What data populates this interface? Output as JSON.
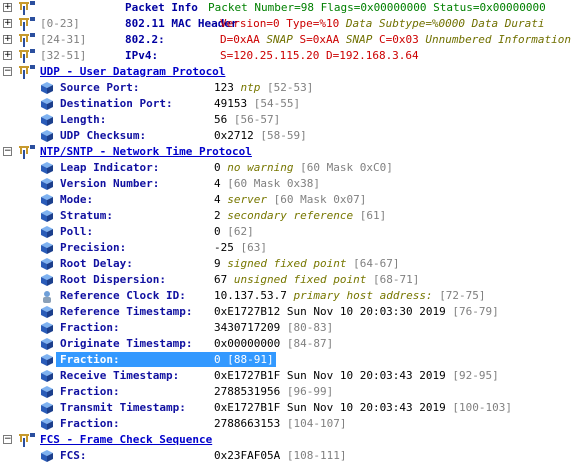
{
  "header_rows": [
    {
      "range": "",
      "name": "Packet Info",
      "parts": [
        {
          "t": "Packet Number=98 Flags=0x00000000 Status=0x00000000",
          "c": "hdr-val"
        }
      ]
    },
    {
      "range": "[0-23]",
      "name": "802.11 MAC Header",
      "parts": [
        {
          "t": "Version=0 Type=%10 ",
          "c": "red"
        },
        {
          "t": "Data Subtype=%0000 Data Durati",
          "c": "grn-it"
        }
      ]
    },
    {
      "range": "[24-31]",
      "name": "802.2:",
      "parts": [
        {
          "t": "D=0xAA ",
          "c": "red"
        },
        {
          "t": "SNAP ",
          "c": "grn-it"
        },
        {
          "t": "S=0xAA ",
          "c": "red"
        },
        {
          "t": "SNAP ",
          "c": "grn-it"
        },
        {
          "t": "C=0x03 ",
          "c": "red"
        },
        {
          "t": "Unnumbered Information",
          "c": "grn-it"
        }
      ]
    },
    {
      "range": "[32-51]",
      "name": "IPv4:",
      "parts": [
        {
          "t": "S=120.25.115.20 D=192.168.3.64",
          "c": "red"
        }
      ]
    }
  ],
  "udp": {
    "title": "UDP - User Datagram Protocol",
    "fields": [
      {
        "name": "Source Port:",
        "value": "123",
        "desc": "ntp",
        "range": "[52-53]"
      },
      {
        "name": "Destination Port:",
        "value": "49153",
        "desc": "",
        "range": "[54-55]"
      },
      {
        "name": "Length:",
        "value": "56",
        "desc": "",
        "range": "[56-57]"
      },
      {
        "name": "UDP Checksum:",
        "value": "0x2712",
        "desc": "",
        "range": "[58-59]"
      }
    ]
  },
  "ntp": {
    "title": "NTP/SNTP - Network Time Protocol",
    "fields": [
      {
        "name": "Leap Indicator:",
        "value": "0",
        "desc": "no warning",
        "range": "[60 Mask 0xC0]"
      },
      {
        "name": "Version Number:",
        "value": "4",
        "desc": "",
        "range": "[60 Mask 0x38]"
      },
      {
        "name": "Mode:",
        "value": "4",
        "desc": "server",
        "range": "[60 Mask 0x07]"
      },
      {
        "name": "Stratum:",
        "value": "2",
        "desc": "secondary reference",
        "range": "[61]"
      },
      {
        "name": "Poll:",
        "value": "0",
        "desc": "",
        "range": "[62]"
      },
      {
        "name": "Precision:",
        "value": "-25",
        "desc": "",
        "range": "[63]"
      },
      {
        "name": "Root Delay:",
        "value": "9",
        "desc": "signed fixed point",
        "range": "[64-67]"
      },
      {
        "name": "Root Dispersion:",
        "value": "67",
        "desc": "unsigned fixed point",
        "range": "[68-71]"
      },
      {
        "name": "Reference Clock ID:",
        "value": "10.137.53.7",
        "desc": "primary host address:",
        "range": "[72-75]",
        "icon": "person"
      },
      {
        "name": "Reference Timestamp:",
        "value": "0xE1727B12  Sun Nov 10 20:03:30 2019",
        "desc": "",
        "range": "[76-79]"
      },
      {
        "name": "Fraction:",
        "value": "3430717209",
        "desc": "",
        "range": "[80-83]"
      },
      {
        "name": "Originate Timestamp:",
        "value": "0x00000000",
        "desc": "",
        "range": "[84-87]"
      },
      {
        "name": "Fraction:",
        "value": "0",
        "desc": "",
        "range": "[88-91]",
        "selected": true
      },
      {
        "name": "Receive Timestamp:",
        "value": "0xE1727B1F  Sun Nov 10 20:03:43 2019",
        "desc": "",
        "range": "[92-95]"
      },
      {
        "name": "Fraction:",
        "value": "2788531956",
        "desc": "",
        "range": "[96-99]"
      },
      {
        "name": "Transmit Timestamp:",
        "value": "0xE1727B1F  Sun Nov 10 20:03:43 2019",
        "desc": "",
        "range": "[100-103]"
      },
      {
        "name": "Fraction:",
        "value": "2788663153",
        "desc": "",
        "range": "[104-107]"
      }
    ]
  },
  "fcs": {
    "title": "FCS - Frame Check Sequence",
    "fields": [
      {
        "name": "FCS:",
        "value": "0x23FAF05A",
        "desc": "",
        "range": "[108-111]"
      }
    ]
  },
  "colors": {
    "selection": "#3399ff",
    "field_name": "#1010a0",
    "section": "#0000cc",
    "range": "#808080"
  }
}
